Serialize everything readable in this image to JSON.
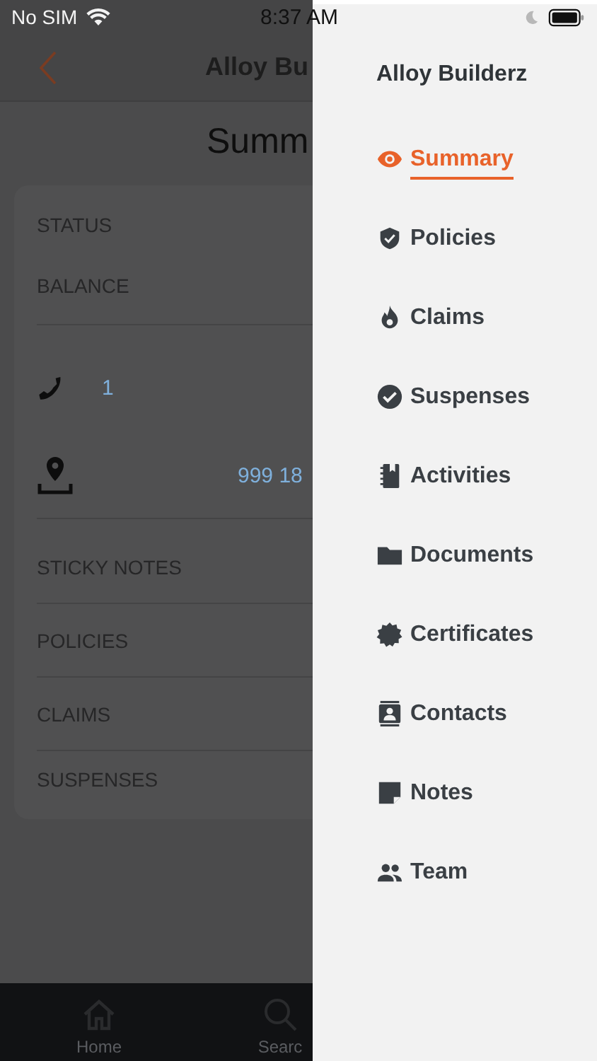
{
  "status_bar": {
    "carrier": "No SIM",
    "time": "8:37 AM"
  },
  "header": {
    "title": "Alloy Bu"
  },
  "page_title": "Summ",
  "card": {
    "rows": [
      {
        "kind": "label",
        "text": "STATUS",
        "divider": false
      },
      {
        "kind": "label",
        "text": "BALANCE",
        "divider": true
      },
      {
        "kind": "phone",
        "text": "1",
        "divider": false
      },
      {
        "kind": "address",
        "text": "999 18",
        "divider": true
      },
      {
        "kind": "label",
        "text": "STICKY NOTES",
        "divider": true
      },
      {
        "kind": "label",
        "text": "POLICIES",
        "divider": true
      },
      {
        "kind": "label",
        "text": "CLAIMS",
        "divider": true
      },
      {
        "kind": "label",
        "text": "SUSPENSES",
        "divider": false
      }
    ]
  },
  "tab_bar": [
    {
      "label": "Home"
    },
    {
      "label": "Searc"
    }
  ],
  "drawer": {
    "title": "Alloy Builderz",
    "items": [
      {
        "label": "Summary",
        "selected": true
      },
      {
        "label": "Policies",
        "selected": false
      },
      {
        "label": "Claims",
        "selected": false
      },
      {
        "label": "Suspenses",
        "selected": false
      },
      {
        "label": "Activities",
        "selected": false
      },
      {
        "label": "Documents",
        "selected": false
      },
      {
        "label": "Certificates",
        "selected": false
      },
      {
        "label": "Contacts",
        "selected": false
      },
      {
        "label": "Notes",
        "selected": false
      },
      {
        "label": "Team",
        "selected": false
      }
    ]
  }
}
